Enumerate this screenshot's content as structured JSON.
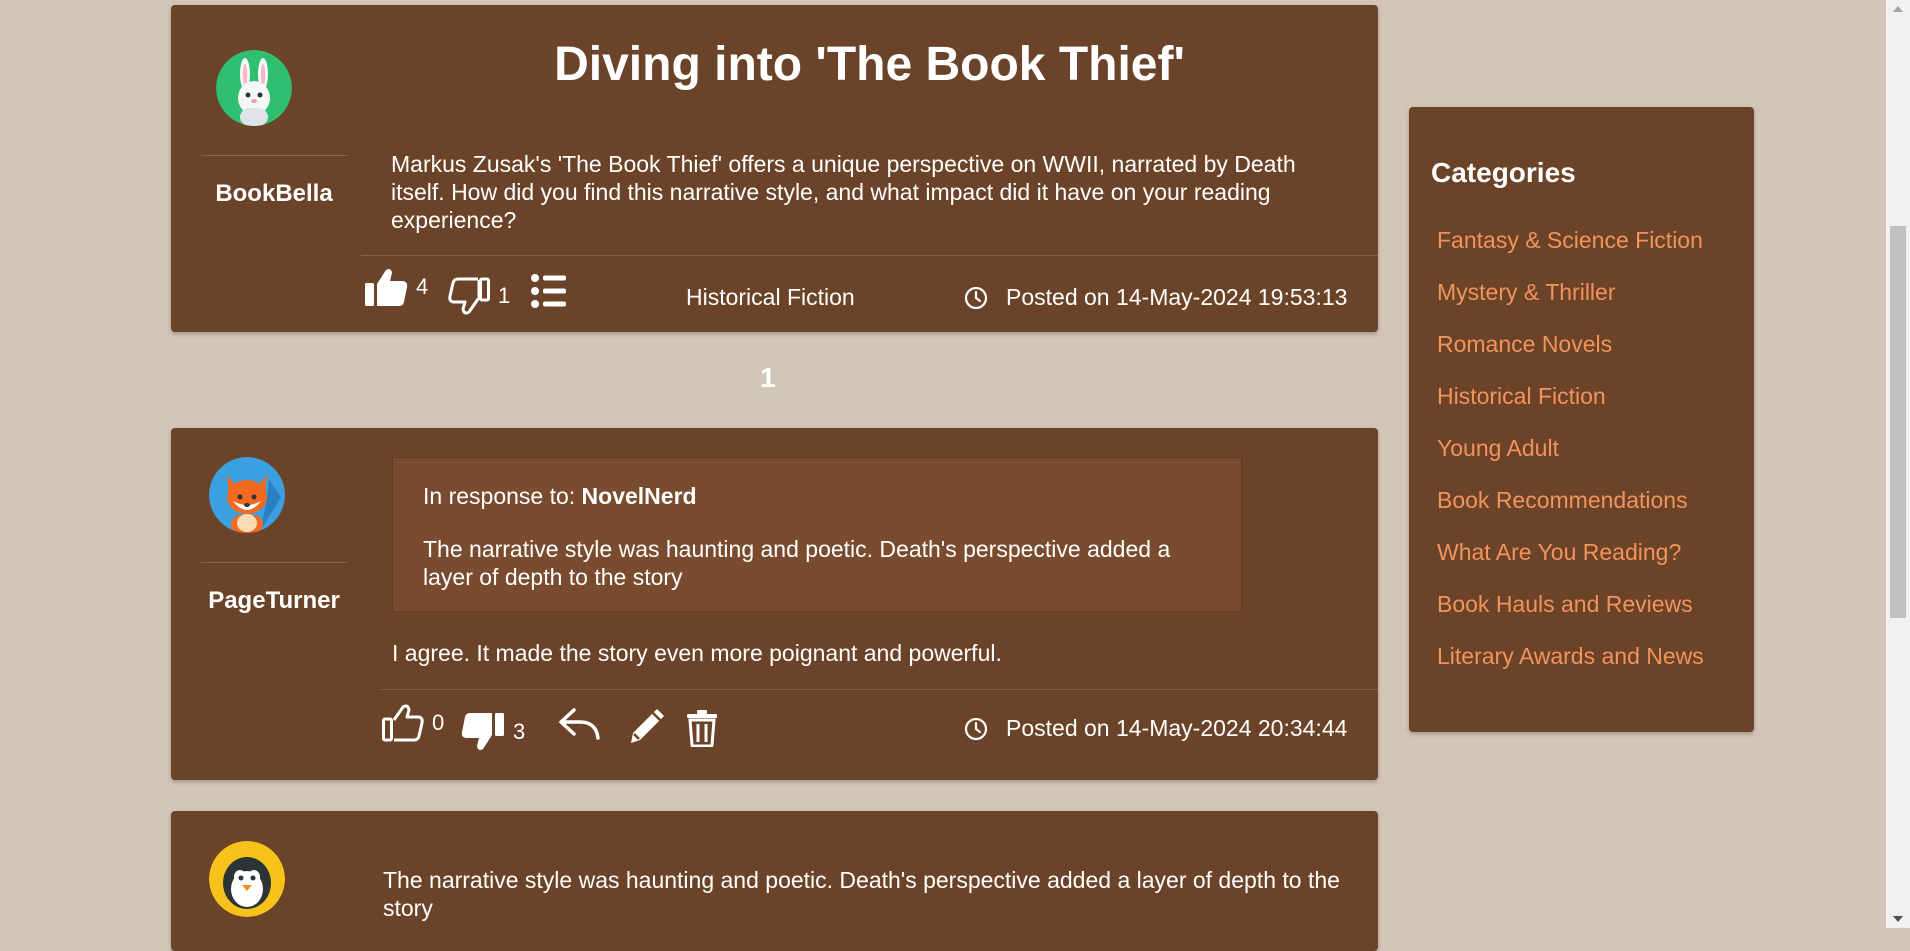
{
  "thread": {
    "title": "Diving into 'The Book Thief'",
    "author": "BookBella",
    "body": "Markus Zusak's 'The Book Thief' offers a unique perspective on WWII, narrated by Death itself. How did you find this narrative style, and what impact did it have on your reading experience?",
    "likes": "4",
    "dislikes": "1",
    "category": "Historical Fiction",
    "posted": "Posted on 14-May-2024 19:53:13"
  },
  "pagination": {
    "current": "1"
  },
  "reply": {
    "author": "PageTurner",
    "quote_prefix": "In response to: ",
    "quote_author": "NovelNerd",
    "quote_text": "The narrative style was haunting and poetic. Death's perspective added a layer of depth to the story",
    "body": "I agree. It made the story even more poignant and powerful.",
    "likes": "0",
    "dislikes": "3",
    "posted": "Posted on 14-May-2024 20:34:44"
  },
  "comment": {
    "body": "The narrative style was haunting and poetic. Death's perspective added a layer of depth to the story"
  },
  "sidebar": {
    "title": "Categories",
    "items": [
      "Fantasy & Science Fiction",
      "Mystery & Thriller",
      "Romance Novels",
      "Historical Fiction",
      "Young Adult",
      "Book Recommendations",
      "What Are You Reading?",
      "Book Hauls and Reviews",
      "Literary Awards and News"
    ]
  },
  "colors": {
    "page_bg": "#d4c5b9",
    "card_bg": "#6b4328",
    "quote_bg": "#7a4c2f",
    "link": "#f2935c"
  },
  "icons": {
    "bunny_avatar": "bunny-icon",
    "fox_avatar": "fox-icon",
    "penguin_avatar": "penguin-icon",
    "like": "thumbs-up-icon",
    "dislike": "thumbs-down-icon",
    "list": "list-icon",
    "clock": "clock-icon",
    "reply": "reply-icon",
    "edit": "pencil-icon",
    "delete": "trash-icon"
  }
}
